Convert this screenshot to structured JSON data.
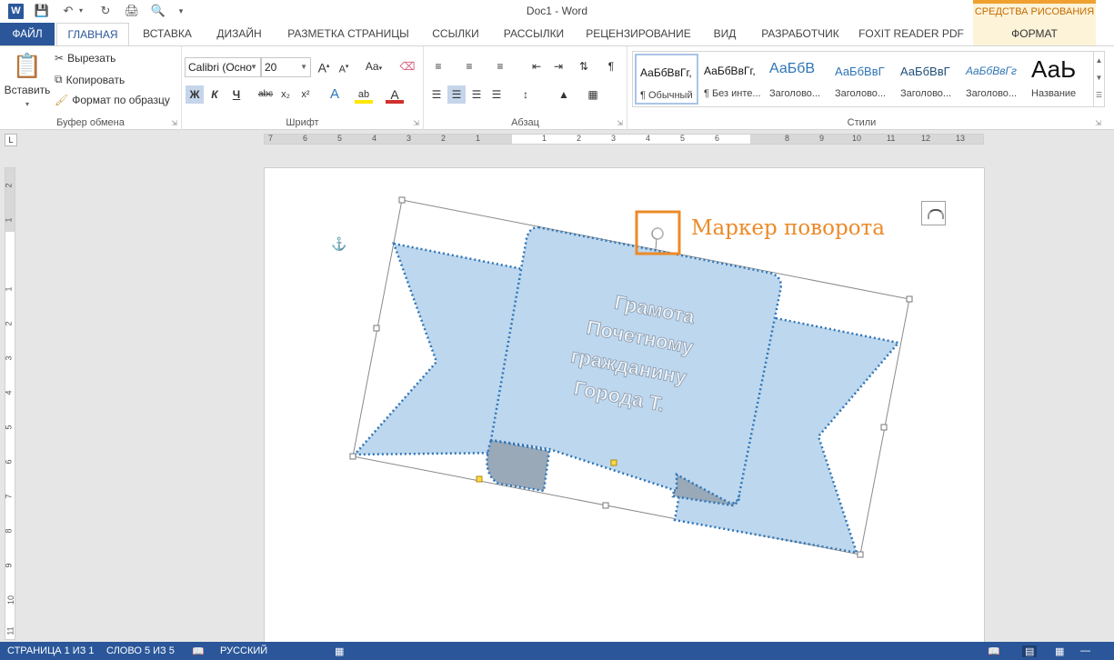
{
  "window": {
    "title": "Doc1 - Word"
  },
  "tabs": {
    "file": "ФАЙЛ",
    "home": "ГЛАВНАЯ",
    "insert": "ВСТАВКА",
    "design": "ДИЗАЙН",
    "layout": "РАЗМЕТКА СТРАНИЦЫ",
    "references": "ССЫЛКИ",
    "mailings": "РАССЫЛКИ",
    "review": "РЕЦЕНЗИРОВАНИЕ",
    "view": "ВИД",
    "developer": "РАЗРАБОТЧИК",
    "foxit": "FOXIT READER PDF",
    "contextual_header": "СРЕДСТВА РИСОВАНИЯ",
    "format": "ФОРМАТ"
  },
  "clipboard": {
    "paste": "Вставить",
    "cut": "Вырезать",
    "copy": "Копировать",
    "format_painter": "Формат по образцу",
    "label": "Буфер обмена"
  },
  "font": {
    "name": "Calibri (Осно",
    "size": "20",
    "bold": "Ж",
    "italic": "К",
    "underline": "Ч",
    "strike": "abc",
    "subscript": "x₂",
    "superscript": "x²",
    "change_case": "Aa",
    "label": "Шрифт"
  },
  "paragraph": {
    "label": "Абзац"
  },
  "styles": {
    "label": "Стили",
    "items": [
      {
        "sample": "АаБбВвГг,",
        "name": "¶ Обычный"
      },
      {
        "sample": "АаБбВвГг,",
        "name": "¶ Без инте..."
      },
      {
        "sample": "АаБбВ",
        "name": "Заголово..."
      },
      {
        "sample": "АаБбВвГ",
        "name": "Заголово..."
      },
      {
        "sample": "АаБбВвГ",
        "name": "Заголово..."
      },
      {
        "sample": "АаБбВвГг",
        "name": "Заголово..."
      },
      {
        "sample": "АаЬ",
        "name": "Название"
      }
    ]
  },
  "ruler": {
    "h_left": [
      "7",
      "6",
      "5",
      "4",
      "3",
      "2",
      "1"
    ],
    "h_right": [
      "1",
      "2",
      "3",
      "4",
      "5",
      "6",
      "7",
      "8",
      "9",
      "10",
      "11",
      "12",
      "13"
    ],
    "v": [
      "2",
      "1",
      "1",
      "2",
      "3",
      "4",
      "5",
      "6",
      "7",
      "8",
      "9",
      "10",
      "11"
    ]
  },
  "shape": {
    "text_lines": [
      "Грамота",
      "Почетному",
      "гражданину",
      "Города Т."
    ],
    "fill": "#bdd7ee",
    "outline": "#2e75b6",
    "fold_fill": "#99a9b8"
  },
  "callout": {
    "label": "Маркер поворота",
    "color": "#ec8a28"
  },
  "statusbar": {
    "page": "СТРАНИЦА 1 ИЗ 1",
    "words": "СЛОВО 5 ИЗ 5",
    "language": "РУССКИЙ"
  }
}
